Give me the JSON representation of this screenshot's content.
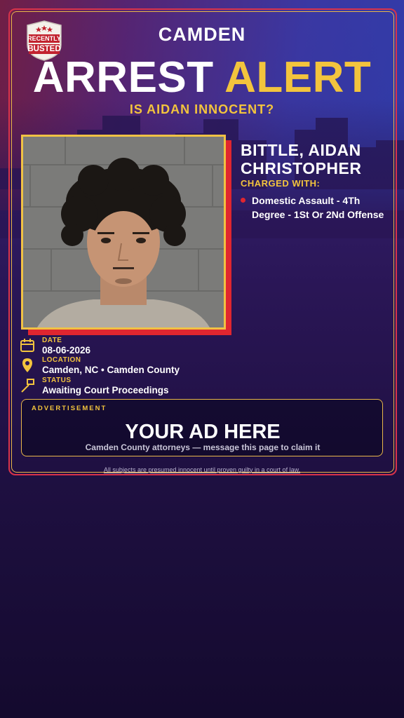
{
  "logo": {
    "line1": "RECENTLY",
    "line2": "BUSTED",
    "icon": "shield-badge-icon"
  },
  "header": {
    "city": "CAMDEN",
    "headline_word1": "ARREST",
    "headline_word2": "ALERT",
    "question": "IS AIDAN INNOCENT?"
  },
  "subject": {
    "name_line1": "BITTLE, AIDAN",
    "name_line2": "CHRISTOPHER",
    "charged_label": "CHARGED WITH:",
    "charges": [
      "Domestic Assault - 4Th Degree - 1St Or 2Nd Offense"
    ]
  },
  "info": {
    "date_label": "DATE",
    "date_value": "08-06-2026",
    "location_label": "LOCATION",
    "location_value": "Camden, NC • Camden County",
    "status_label": "STATUS",
    "status_value": "Awaiting Court Proceedings"
  },
  "ad": {
    "label": "ADVERTISEMENT",
    "title": "YOUR AD HERE",
    "subtitle": "Camden County attorneys — message this page to claim it"
  },
  "disclaimer": "All subjects are presumed innocent until proven guilty in a court of law.",
  "colors": {
    "accent_gold": "#f3c43d",
    "accent_red": "#e0262f",
    "background_dark": "#1f1042"
  }
}
